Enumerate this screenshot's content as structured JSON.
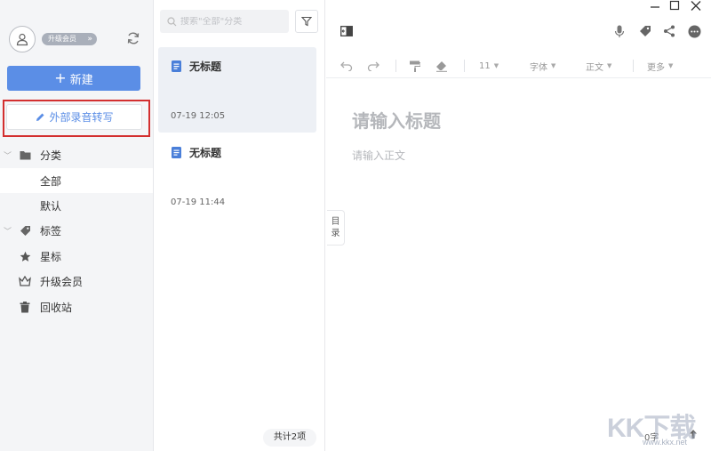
{
  "sidebar": {
    "vip_badge": "升级会员",
    "new_button": "新建",
    "transcribe_button": "外部录音转写",
    "items": [
      {
        "label": "分类"
      },
      {
        "label": "全部"
      },
      {
        "label": "默认"
      },
      {
        "label": "标签"
      },
      {
        "label": "星标"
      },
      {
        "label": "升级会员"
      },
      {
        "label": "回收站"
      }
    ]
  },
  "notelist": {
    "search_placeholder": "搜索\"全部\"分类",
    "notes": [
      {
        "title": "无标题",
        "time": "07-19 12:05"
      },
      {
        "title": "无标题",
        "time": "07-19 11:44"
      }
    ],
    "count": "共计2项"
  },
  "editor": {
    "font_size": "11",
    "font_label": "字体",
    "style_label": "正文",
    "more_label": "更多",
    "title_placeholder": "请输入标题",
    "body_placeholder": "请输入正文",
    "toc_line1": "目",
    "toc_line2": "录",
    "word_count": "0字"
  },
  "watermark": {
    "text": "KK下载",
    "url": "www.kkx.net"
  },
  "colors": {
    "accent": "#5b8ee6",
    "highlight_border": "#d32f2f"
  }
}
